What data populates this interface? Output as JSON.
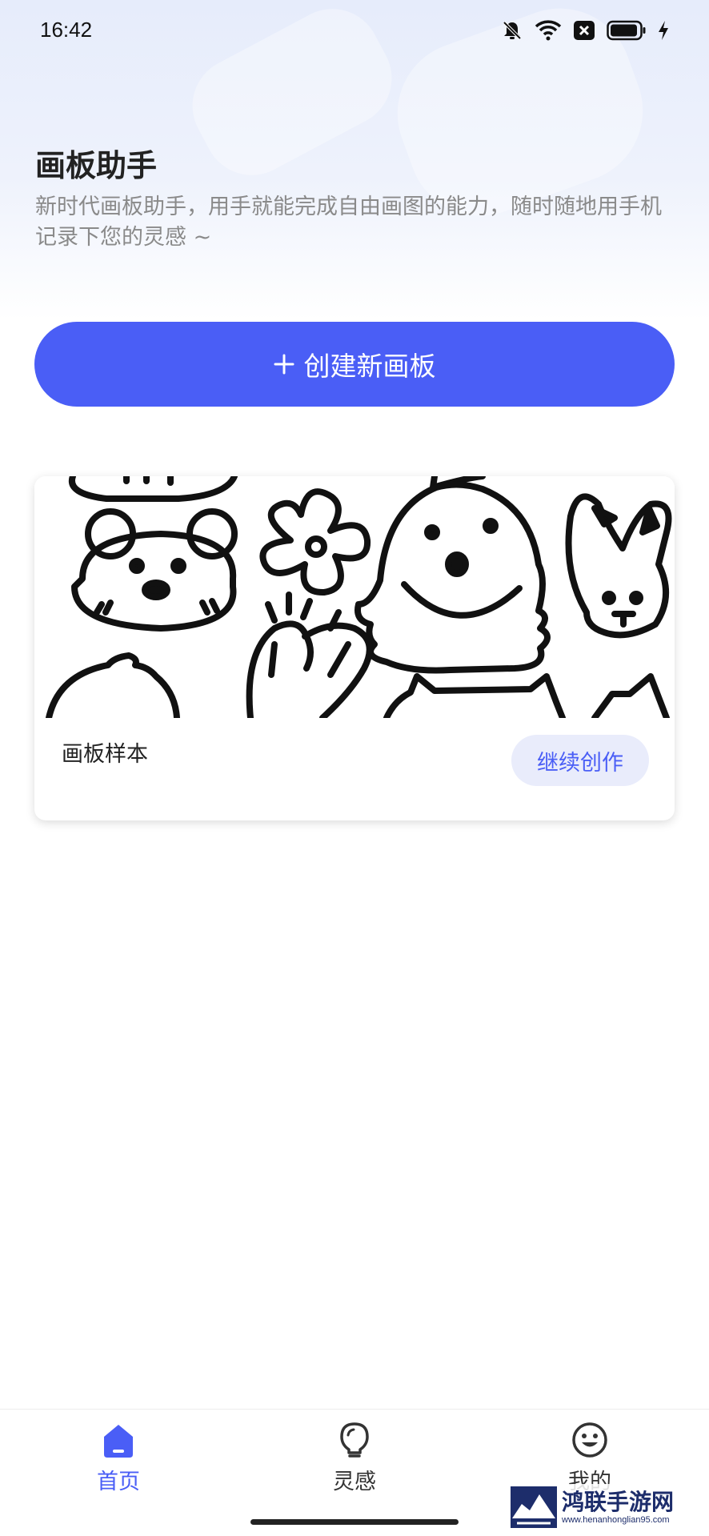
{
  "status_bar": {
    "time": "16:42",
    "icons": [
      "bell-off-icon",
      "wifi-icon",
      "close-box-icon",
      "battery-icon",
      "charging-icon"
    ]
  },
  "header": {
    "title": "画板助手",
    "subtitle": "新时代画板助手，用手就能完成自由画图的能力，随时随地用手机记录下您的灵感 ~"
  },
  "create_button": {
    "icon": "plus-icon",
    "label": "创建新画板"
  },
  "card": {
    "title": "画板样本",
    "continue_label": "继续创作",
    "thumbnail": "doodle-animals-image"
  },
  "tabs": [
    {
      "label": "首页",
      "icon": "home-icon",
      "active": true
    },
    {
      "label": "灵感",
      "icon": "lightbulb-icon",
      "active": false
    },
    {
      "label": "我的",
      "icon": "smiley-icon",
      "active": false
    }
  ],
  "watermark": {
    "name": "鸿联手游网",
    "url": "www.henanhonglian95.com"
  },
  "colors": {
    "accent": "#4a5ef6",
    "accent_light": "#e9ecfb",
    "subtitle_gray": "#8a8a8a"
  }
}
